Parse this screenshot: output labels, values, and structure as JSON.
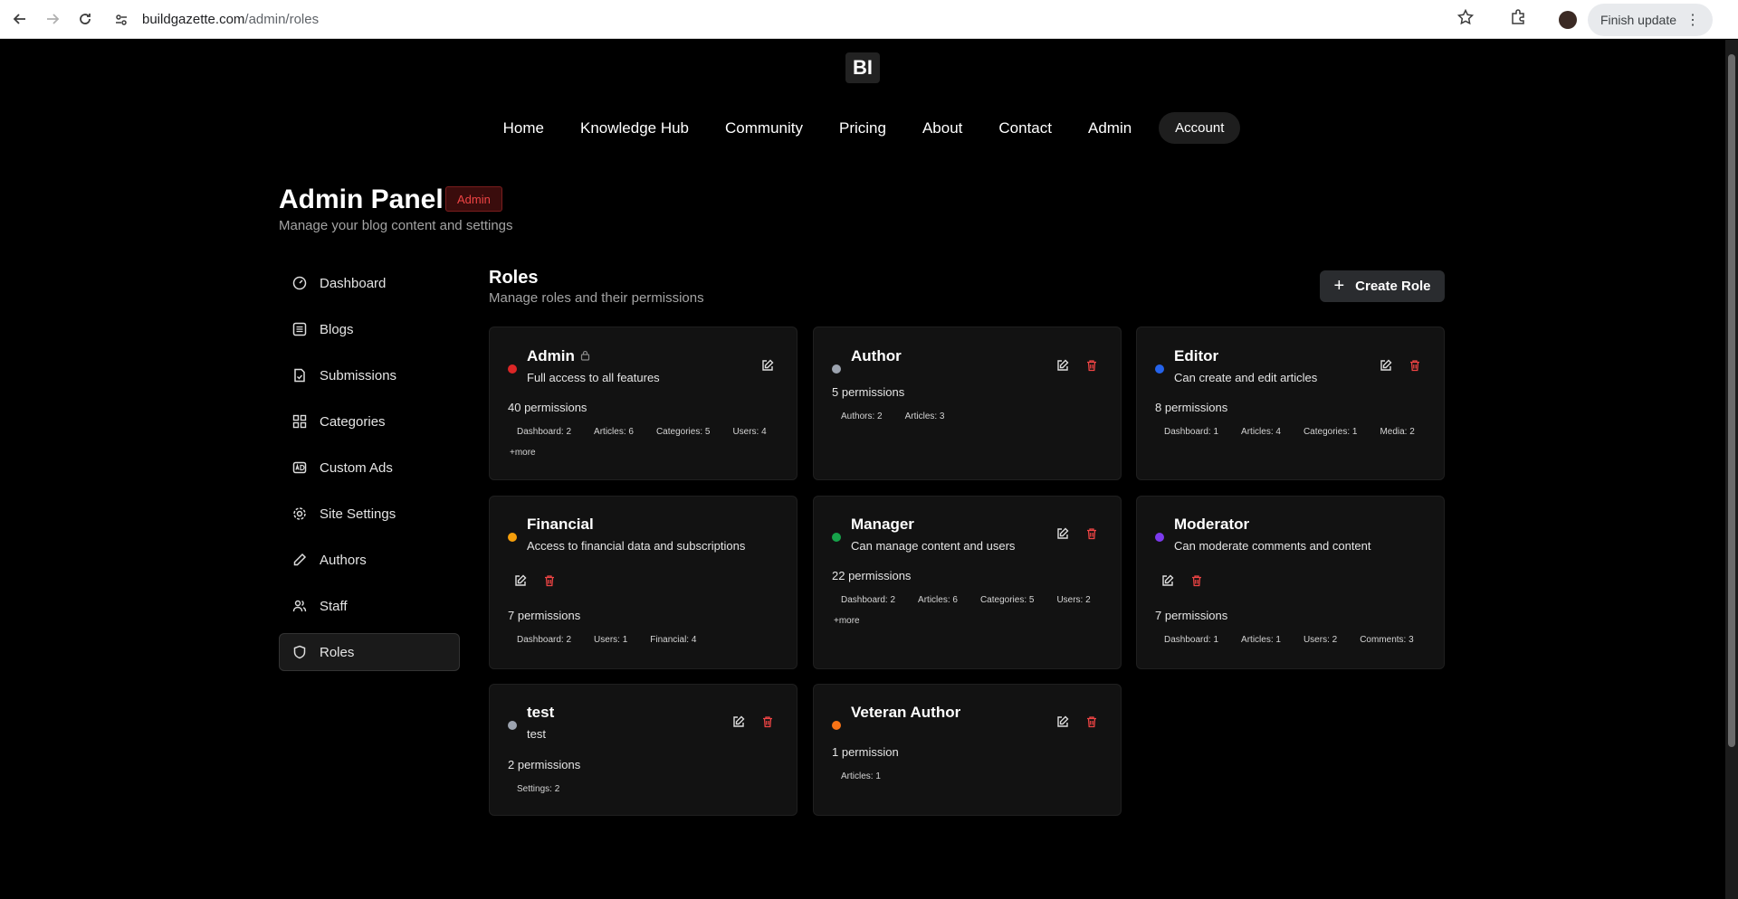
{
  "browser": {
    "url_domain": "buildgazette.com",
    "url_path": "/admin/roles",
    "finish_update_label": "Finish update"
  },
  "site": {
    "logo_text": "BI",
    "nav": [
      "Home",
      "Knowledge Hub",
      "Community",
      "Pricing",
      "About",
      "Contact",
      "Admin"
    ],
    "account_label": "Account"
  },
  "admin": {
    "title": "Admin Panel",
    "badge": "Admin",
    "subtitle": "Manage your blog content and settings"
  },
  "sidebar": {
    "items": [
      {
        "label": "Dashboard",
        "icon": "dashboard-icon"
      },
      {
        "label": "Blogs",
        "icon": "list-icon"
      },
      {
        "label": "Submissions",
        "icon": "file-check-icon"
      },
      {
        "label": "Categories",
        "icon": "grid-icon"
      },
      {
        "label": "Custom Ads",
        "icon": "ad-icon"
      },
      {
        "label": "Site Settings",
        "icon": "gear-icon"
      },
      {
        "label": "Authors",
        "icon": "pen-icon"
      },
      {
        "label": "Staff",
        "icon": "users-icon"
      },
      {
        "label": "Roles",
        "icon": "shield-icon",
        "active": true
      }
    ]
  },
  "roles": {
    "title": "Roles",
    "subtitle": "Manage roles and their permissions",
    "create_label": "Create Role",
    "cards": [
      {
        "name": "Admin",
        "color": "#dc2626",
        "description": "Full access to all features",
        "locked": true,
        "perm_count": "40 permissions",
        "tags": [
          "Dashboard: 2",
          "Articles: 6",
          "Categories: 5",
          "Users: 4"
        ],
        "more": "+more"
      },
      {
        "name": "Author",
        "color": "#9ca3af",
        "description": "",
        "perm_count": "5 permissions",
        "tags": [
          "Authors: 2",
          "Articles: 3"
        ]
      },
      {
        "name": "Editor",
        "color": "#2563eb",
        "description": "Can create and edit articles",
        "perm_count": "8 permissions",
        "tags": [
          "Dashboard: 1",
          "Articles: 4",
          "Categories: 1",
          "Media: 2"
        ]
      },
      {
        "name": "Financial",
        "color": "#f59e0b",
        "description": "Access to financial data and subscriptions",
        "perm_count": "7 permissions",
        "tags": [
          "Dashboard: 2",
          "Users: 1",
          "Financial: 4"
        ]
      },
      {
        "name": "Manager",
        "color": "#16a34a",
        "description": "Can manage content and users",
        "perm_count": "22 permissions",
        "tags": [
          "Dashboard: 2",
          "Articles: 6",
          "Categories: 5",
          "Users: 2"
        ],
        "more": "+more"
      },
      {
        "name": "Moderator",
        "color": "#7c3aed",
        "description": "Can moderate comments and content",
        "perm_count": "7 permissions",
        "tags": [
          "Dashboard: 1",
          "Articles: 1",
          "Users: 2",
          "Comments: 3"
        ]
      },
      {
        "name": "test",
        "color": "#9ca3af",
        "description": "test",
        "perm_count": "2 permissions",
        "tags": [
          "Settings: 2"
        ]
      },
      {
        "name": "Veteran Author",
        "color": "#f97316",
        "description": "",
        "perm_count": "1 permission",
        "tags": [
          "Articles: 1"
        ]
      }
    ]
  }
}
